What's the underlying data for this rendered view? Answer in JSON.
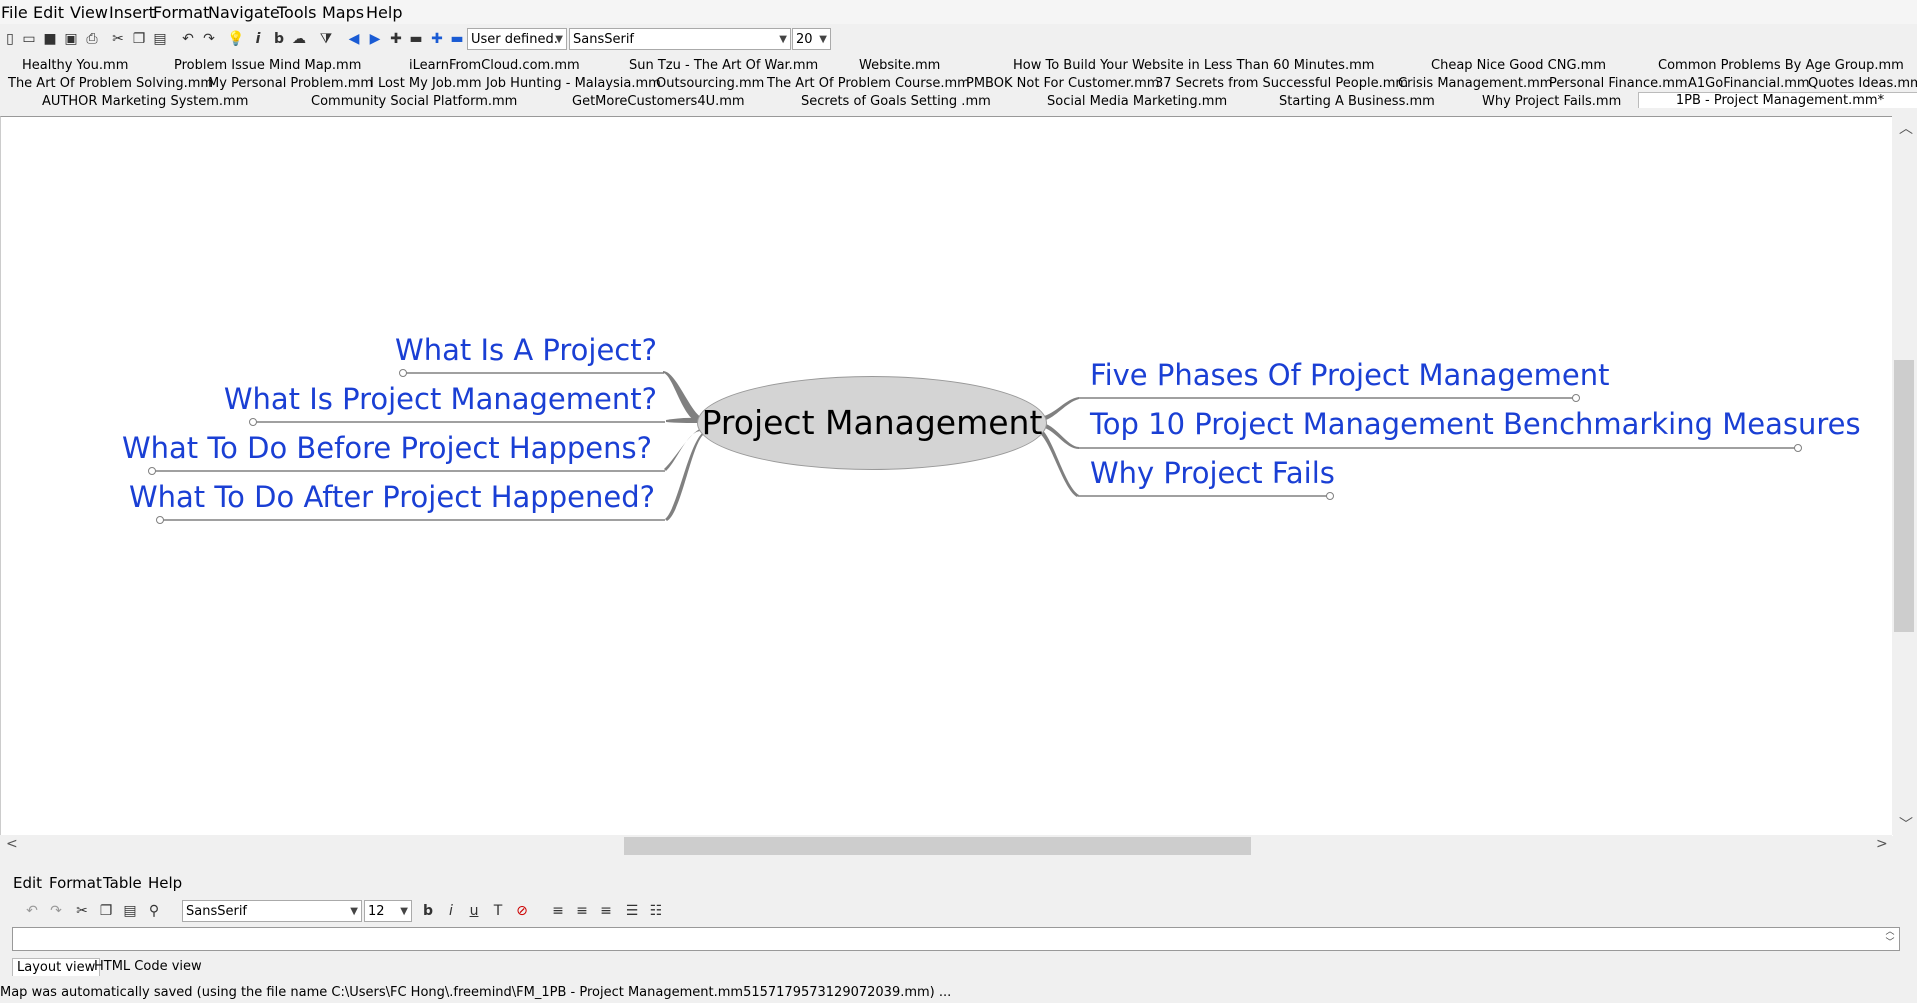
{
  "menu": [
    "File",
    "Edit",
    "View",
    "Insert",
    "Format",
    "Navigate",
    "Tools",
    "Maps",
    "Help"
  ],
  "toolbar": {
    "icons": [
      "new-icon",
      "open-icon",
      "save-icon",
      "save-as-icon",
      "print-icon",
      "cut-icon",
      "copy-icon",
      "paste-icon",
      "undo-icon",
      "redo-icon",
      "idea-icon",
      "italic-icon",
      "bold-icon",
      "cloud-icon",
      "filter-icon",
      "back-icon",
      "forward-icon",
      "add-node-icon",
      "remove-node-icon",
      "add-sibling-icon",
      "remove-sibling-icon"
    ],
    "style_combo": "User defined.",
    "font_combo": "SansSerif",
    "size_combo": "20"
  },
  "tabs": {
    "row1": [
      "Healthy You.mm",
      "Problem Issue Mind Map.mm",
      "iLearnFromCloud.com.mm",
      "Sun Tzu - The Art Of War.mm",
      "Website.mm",
      "How To Build Your Website in Less Than 60 Minutes.mm",
      "Cheap Nice Good CNG.mm",
      "Common Problems By Age Group.mm"
    ],
    "row2": [
      "The Art Of Problem Solving.mm",
      "My Personal Problem.mm",
      "I Lost My Job.mm",
      "Job Hunting - Malaysia.mm",
      "Outsourcing.mm",
      "The Art Of Problem Course.mm",
      "PMBOK Not For Customer.mm",
      "37 Secrets from Successful People.mm",
      "Crisis Management.mm",
      "Personal Finance.mm",
      "A1GoFinancial.mm",
      "Quotes Ideas.mm"
    ],
    "row3": [
      "AUTHOR Marketing System.mm",
      "Community Social Platform.mm",
      "GetMoreCustomers4U.mm",
      "Secrets of Goals Setting .mm",
      "Social Media Marketing.mm",
      "Starting A Business.mm",
      "Why Project Fails.mm",
      "1PB - Project Management.mm*"
    ]
  },
  "mindmap": {
    "root": "Project Management",
    "left": [
      "What Is A Project?",
      "What Is Project Management?",
      "What To Do Before Project Happens?",
      "What To Do After Project Happened?"
    ],
    "right": [
      "Five Phases Of Project Management",
      "Top 10 Project Management Benchmarking Measures",
      "Why Project Fails"
    ]
  },
  "editor": {
    "menu": [
      "Edit",
      "Format",
      "Table",
      "Help"
    ],
    "font": "SansSerif",
    "size": "12",
    "view_tabs": [
      "Layout view",
      "HTML Code view"
    ]
  },
  "status": "Map was automatically saved (using the file name C:\\Users\\FC Hong\\.freemind\\FM_1PB - Project Management.mm5157179573129072039.mm) ..."
}
